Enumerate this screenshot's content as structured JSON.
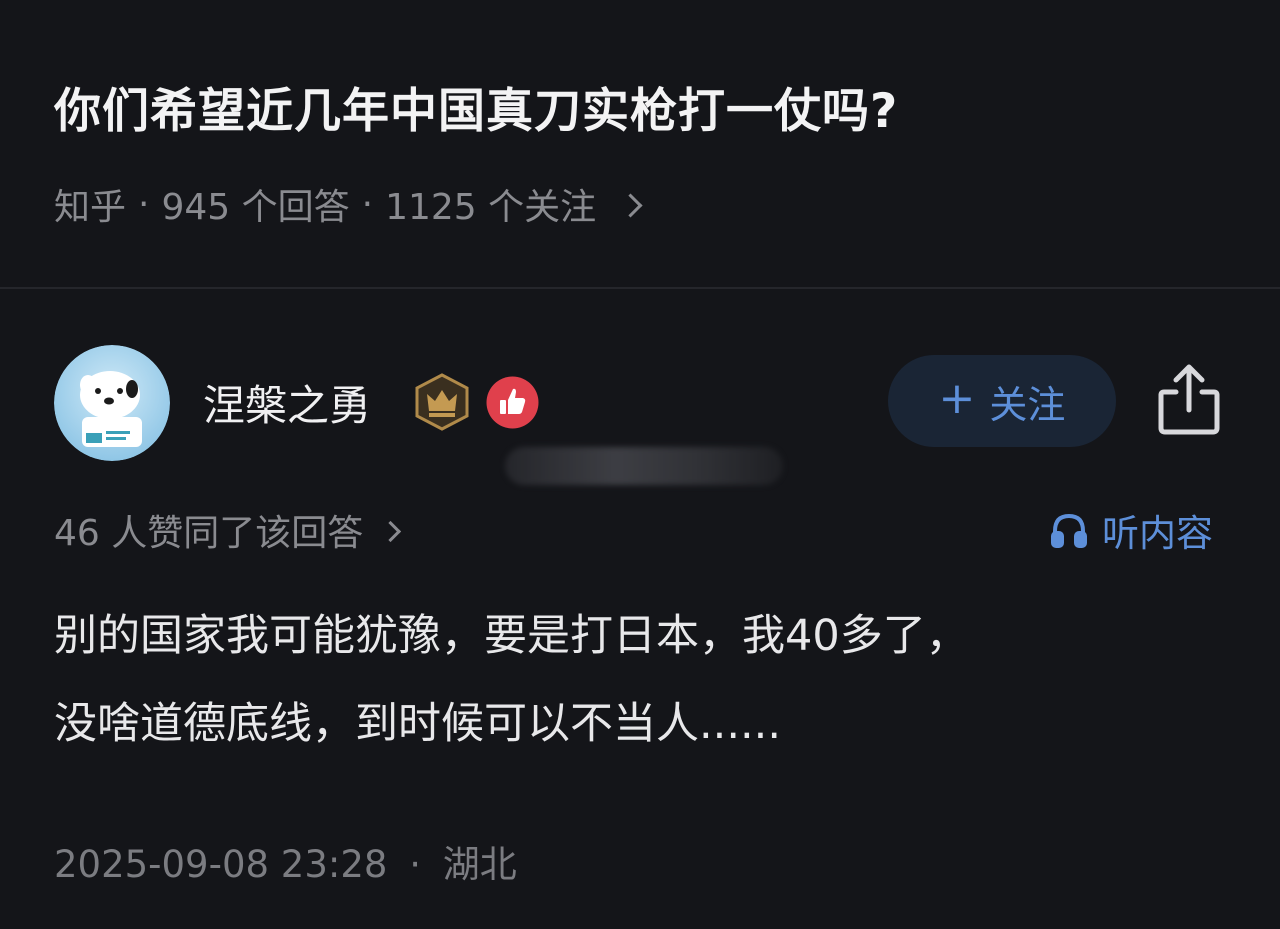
{
  "question": {
    "title": "你们希望近几年中国真刀实枪打一仗吗?",
    "source": "知乎",
    "answers_count": "945 个回答",
    "followers_count": "1125 个关注"
  },
  "author": {
    "name": "涅槃之勇",
    "badges": [
      "crown-badge-icon",
      "thumbs-up-badge-icon"
    ],
    "follow_label": "关注",
    "accent_color": "#5d8fd9"
  },
  "answer": {
    "vote_text": "46 人赞同了该回答",
    "listen_label": "听内容",
    "lines": [
      "别的国家我可能犹豫，要是打日本，我40多了，",
      "没啥道德底线，到时候可以不当人......"
    ],
    "timestamp": "2025-09-08 23:28",
    "location": "湖北"
  }
}
